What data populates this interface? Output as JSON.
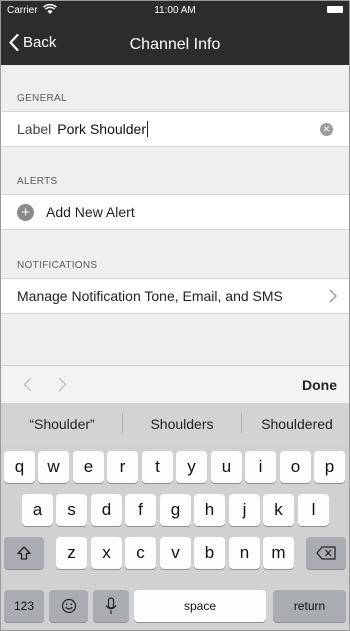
{
  "status_bar": {
    "carrier": "Carrier",
    "time": "11:00 AM"
  },
  "nav": {
    "back_label": "Back",
    "title": "Channel Info"
  },
  "sections": {
    "general": {
      "header": "GENERAL",
      "label_caption": "Label",
      "label_value": "Pork Shoulder"
    },
    "alerts": {
      "header": "ALERTS",
      "add_alert_label": "Add New Alert"
    },
    "notifications": {
      "header": "NOTIFICATIONS",
      "manage_label": "Manage Notification Tone, Email, and SMS"
    }
  },
  "accessory": {
    "done_label": "Done"
  },
  "keyboard": {
    "suggestions": [
      "“Shoulder”",
      "Shoulders",
      "Shouldered"
    ],
    "row1": [
      "q",
      "w",
      "e",
      "r",
      "t",
      "y",
      "u",
      "i",
      "o",
      "p"
    ],
    "row2": [
      "a",
      "s",
      "d",
      "f",
      "g",
      "h",
      "j",
      "k",
      "l"
    ],
    "row3": [
      "z",
      "x",
      "c",
      "v",
      "b",
      "n",
      "m"
    ],
    "numbers_label": "123",
    "space_label": "space",
    "return_label": "return"
  },
  "icons": {
    "wifi": "wifi-icon",
    "battery": "battery-icon",
    "back": "chevron-left-icon",
    "clear": "clear-circle-icon",
    "add": "plus-circle-icon",
    "disclosure": "chevron-right-icon",
    "prev": "chevron-left-icon",
    "next": "chevron-right-icon",
    "shift": "shift-icon",
    "delete": "delete-backspace-icon",
    "emoji": "emoji-icon",
    "mic": "microphone-icon"
  }
}
